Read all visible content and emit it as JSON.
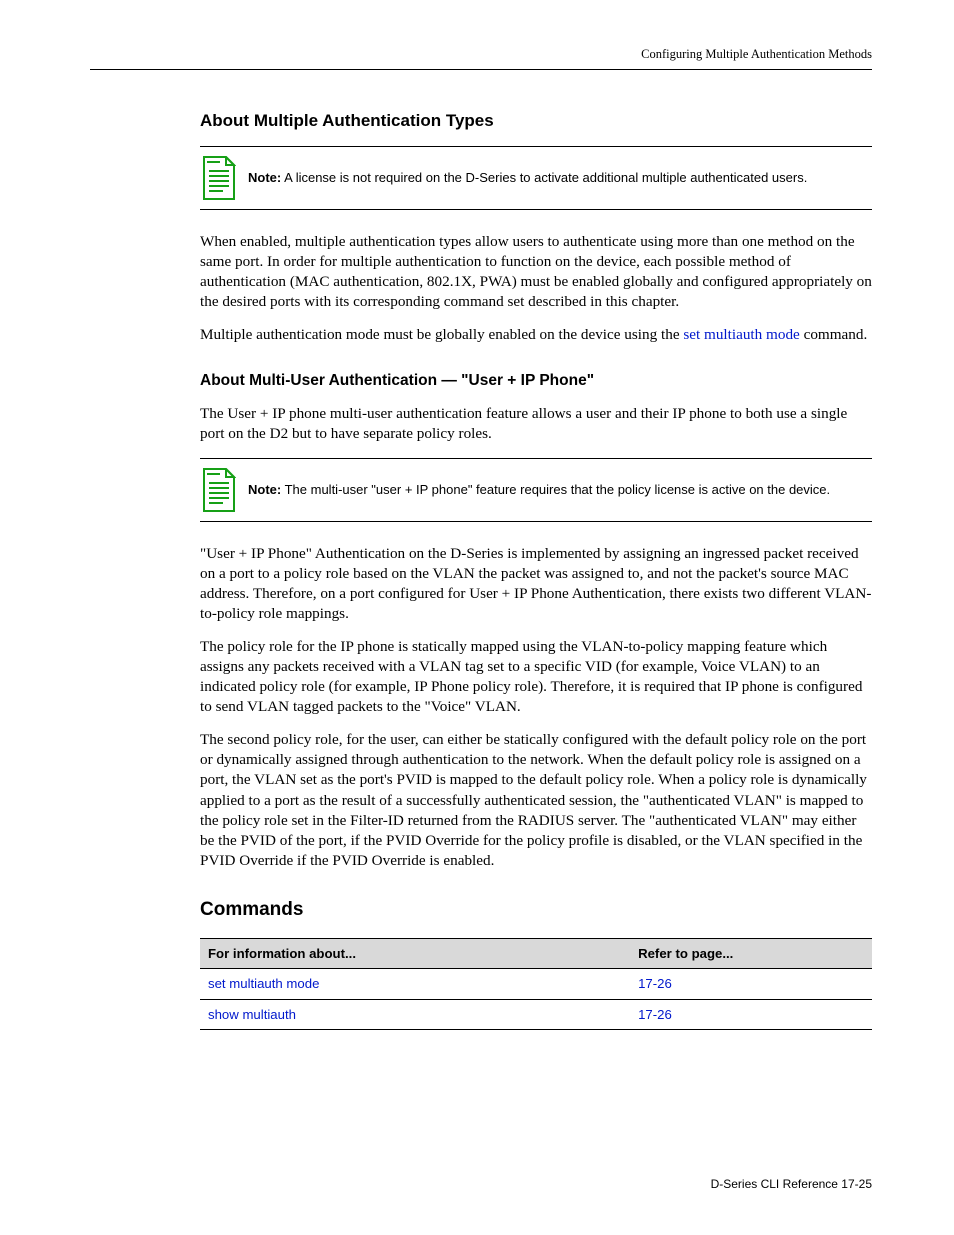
{
  "header": {
    "running": "Configuring Multiple Authentication Methods"
  },
  "sections": {
    "s1_heading": "About Multiple Authentication Types",
    "note1": {
      "label": "Note:",
      "text": "A license is not required on the D-Series to activate additional multiple authenticated users."
    },
    "p1": "When enabled, multiple authentication types allow users to authenticate using more than one method on the same port. In order for multiple authentication to function on the device, each possible method of authentication (MAC authentication, 802.1X, PWA) must be enabled globally and configured appropriately on the desired ports with its corresponding command set described in this chapter.",
    "p2a": "Multiple authentication mode must be globally enabled on the device using the ",
    "p2_link": "set multiauth mode",
    "p2b": " command.",
    "s2_heading": "About Multi-User Authentication — \"User + IP Phone\"",
    "p3": "The User + IP phone multi-user authentication feature allows a user and their IP phone to both use a single port on the D2 but to have separate policy roles.",
    "note2": {
      "label": "Note:",
      "text": "The multi-user \"user + IP phone\" feature requires that the policy license is active on the device."
    },
    "p4": "\"User + IP Phone\" Authentication on the D-Series is implemented by assigning an ingressed packet received on a port to a policy role based on the VLAN the packet was assigned to, and not the packet's source MAC address. Therefore, on a port configured for User + IP Phone Authentication, there exists two different VLAN-to-policy role mappings.",
    "p5": "The policy role for the IP phone is statically mapped using the VLAN-to-policy mapping feature which assigns any packets received with a VLAN tag set to a specific VID (for example, Voice VLAN) to an indicated policy role (for example, IP Phone policy role). Therefore, it is required that IP phone is configured to send VLAN tagged packets to the \"Voice\" VLAN.",
    "p6": "The second policy role, for the user, can either be statically configured with the default policy role on the port or dynamically assigned through authentication to the network. When the default policy role is assigned on a port, the VLAN set as the port's PVID is mapped to the default policy role. When a policy role is dynamically applied to a port as the result of a successfully authenticated session, the \"authenticated VLAN\" is mapped to the policy role set in the Filter-ID returned from the RADIUS server. The \"authenticated VLAN\" may either be the PVID of the port, if the PVID Override for the policy profile is disabled, or the VLAN specified in the PVID Override if the PVID Override is enabled.",
    "cmd_heading": "Commands"
  },
  "table": {
    "headers": [
      "For information about...",
      "Refer to page..."
    ],
    "rows": [
      {
        "label": "set multiauth mode",
        "page": "17-26"
      },
      {
        "label": "show multiauth",
        "page": "17-26"
      }
    ]
  },
  "footer": {
    "text": "D-Series CLI Reference 17-25"
  }
}
